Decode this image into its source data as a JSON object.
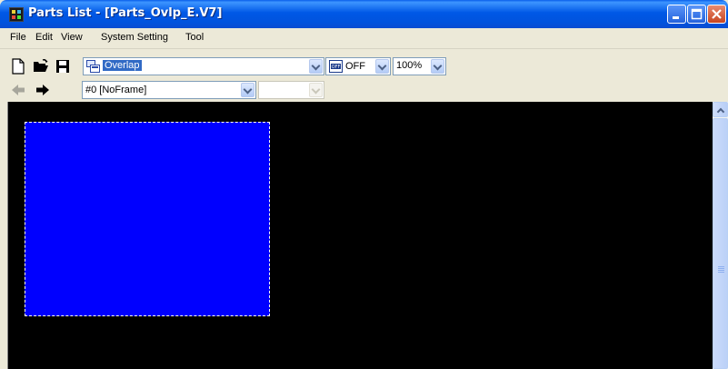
{
  "window": {
    "title": "Parts List - [Parts_Ovlp_E.V7]"
  },
  "menubar": {
    "items": [
      "File",
      "Edit",
      "View",
      "System Setting",
      "Tool"
    ]
  },
  "toolbar1": {
    "layer_combo_value": "Overlap",
    "off_label": "OFF",
    "zoom_value": "100%"
  },
  "toolbar2": {
    "frame_combo_value": "#0 [NoFrame]",
    "second_combo_value": ""
  },
  "colors": {
    "titlebar": "#0058E6",
    "canvas_bg": "#000000",
    "part_fill": "#0000FF",
    "selection_border": "#FFFFFF"
  },
  "icons": [
    "app-icon",
    "new-file-icon",
    "open-folder-icon",
    "save-icon",
    "layer-icon",
    "off-toggle-icon",
    "back-arrow-icon",
    "forward-arrow-icon",
    "minimize-icon",
    "maximize-icon",
    "close-icon",
    "scroll-up-icon"
  ]
}
